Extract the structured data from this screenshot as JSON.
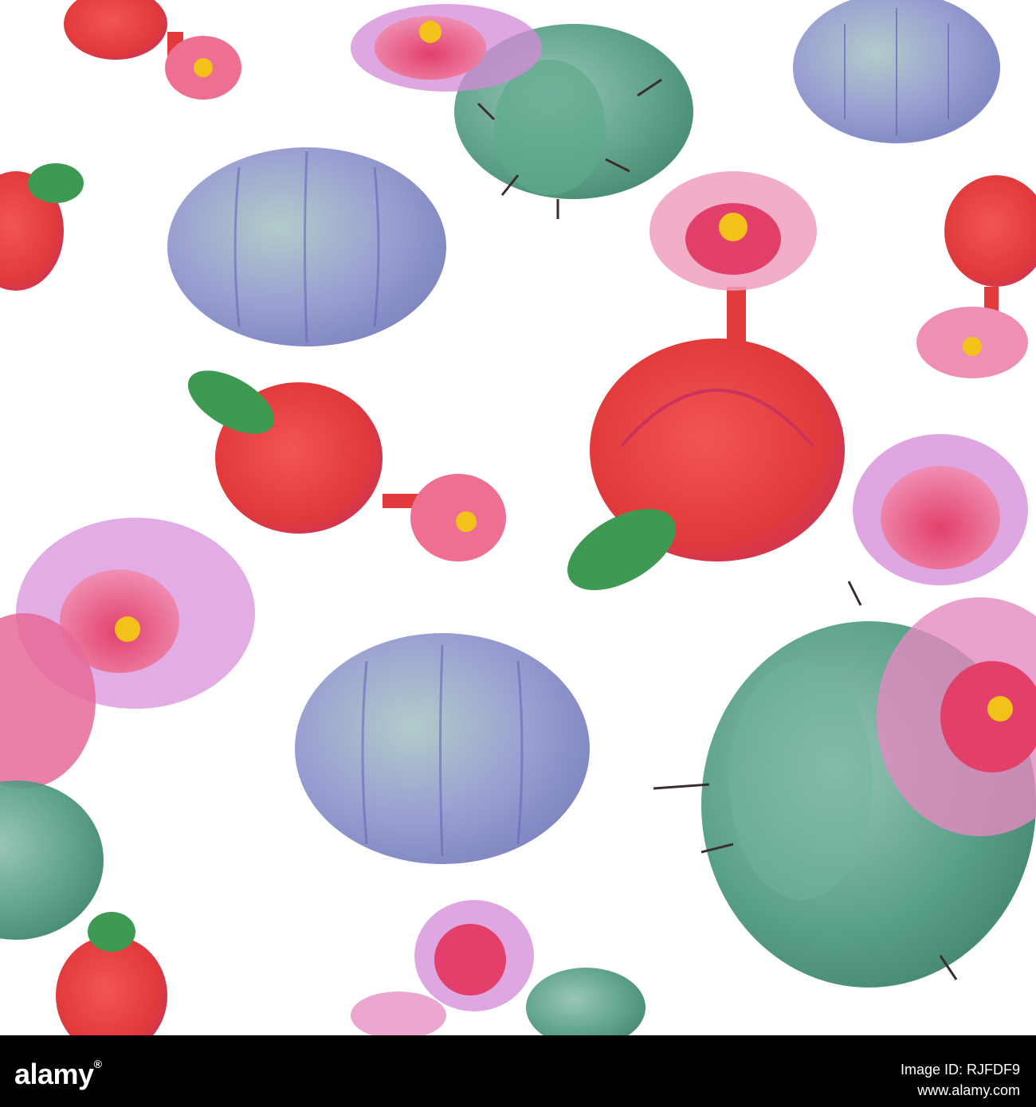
{
  "palette": {
    "background": "#ffffff",
    "cactus_green": "#3f8f73",
    "cactus_blue": "#7f86c9",
    "flower_pink": "#e7739a",
    "flower_red": "#e23a3a",
    "flower_center": "#f3c21a",
    "spine": "#3a2d2d"
  },
  "footer": {
    "logo_text": "alamy",
    "logo_mark": "®",
    "label": "Image ID:",
    "image_id": "RJFDF9",
    "site": "www.alamy.com"
  }
}
